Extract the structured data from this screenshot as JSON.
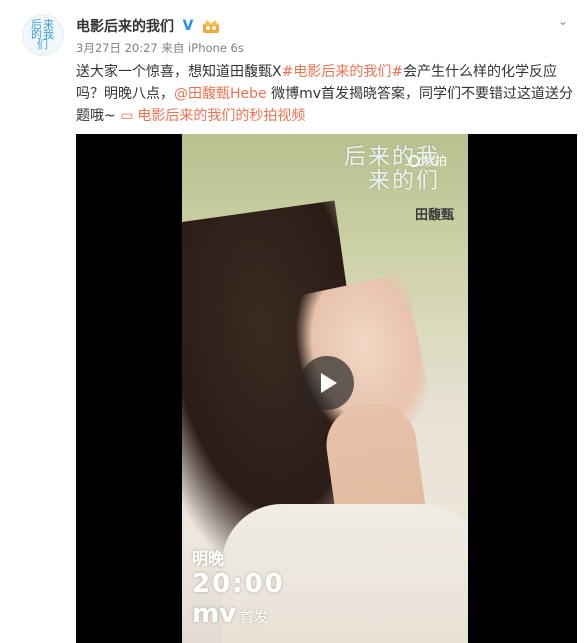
{
  "post": {
    "avatar_logo_text": "后来的我们",
    "username": "电影后来的我们",
    "verified_badge_icon": "verified-v-icon",
    "member_badge_icon": "crown-badge-icon",
    "menu_icon": "chevron-down-icon",
    "date": "3月27日 20:27",
    "from": "来自 iPhone 6s",
    "text_parts": {
      "part1": "送大家一个惊喜，想知道田馥甄X",
      "hashtag": "#电影后来的我们#",
      "part2": "会产生什么样的化学反应吗？明晚八点，",
      "mention": "@田馥甄Hebe",
      "part3": " 微博mv首发揭晓答案，同学们不要错过这道送分题哦~ ",
      "video_link": "电影后来的我们的秒拍视频"
    }
  },
  "video": {
    "watermark": "秒拍",
    "overlay_title_line1": "后来的我",
    "overlay_title_line2": "来的们",
    "singer": "田馥甄",
    "promo_line1": "明晚",
    "promo_time": "20:00",
    "promo_mv": "mv",
    "promo_first": "首发",
    "play_icon": "play-icon"
  },
  "colors": {
    "link": "#eb7350",
    "verified": "#1e90ff",
    "text": "#333333",
    "meta": "#808080"
  }
}
